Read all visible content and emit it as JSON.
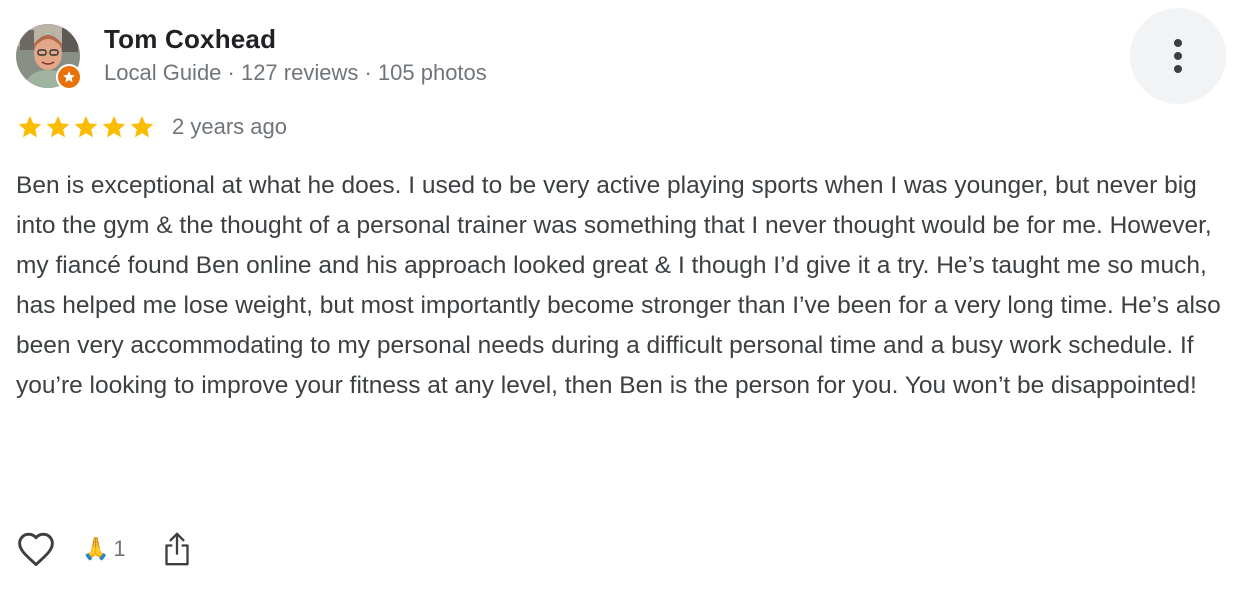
{
  "review": {
    "author": {
      "name": "Tom Coxhead",
      "meta": "Local Guide · 127 reviews · 105 photos",
      "avatar_icon": "avatar",
      "badge_icon": "local-guide-star-icon",
      "badge_color": "#e8710a"
    },
    "rating": {
      "stars": 5,
      "max_stars": 5,
      "star_color": "#fbbc04",
      "time_ago": "2 years ago"
    },
    "text": "Ben is exceptional at what he does. I used to be very active playing sports when I was younger, but never big into the gym & the thought of a personal trainer was something that I never thought would be for me. However, my fiancé found Ben online and his approach looked great & I though I’d give it a try. He’s taught me so much, has helped me lose weight, but most importantly become stronger than I’ve been for a very long time. He’s also been very accommodating to my personal needs during a difficult personal time and a busy work schedule. If you’re looking to improve your fitness at any level, then Ben is the person for you. You won’t be disappointed!",
    "actions": {
      "like_icon": "heart-outline-icon",
      "reaction_emoji": "🙏",
      "reaction_count": "1",
      "share_icon": "share-icon",
      "more_icon": "more-vertical-icon"
    }
  }
}
